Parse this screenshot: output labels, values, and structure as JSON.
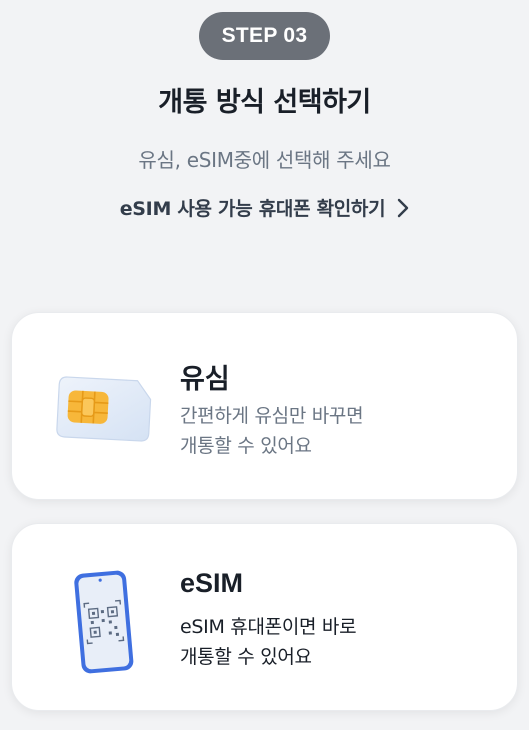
{
  "step_badge": "STEP 03",
  "title": "개통 방식 선택하기",
  "subtitle": "유심, eSIM중에 선택해 주세요",
  "check_link": "eSIM 사용 가능 휴대폰 확인하기",
  "options": [
    {
      "title": "유심",
      "desc_line1": "간편하게 유심만 바꾸면",
      "desc_line2": "개통할 수 있어요",
      "icon": "sim-card-icon"
    },
    {
      "title": "eSIM",
      "desc_line1": "eSIM 휴대폰이면 바로",
      "desc_line2": "개통할 수 있어요",
      "icon": "phone-qr-icon"
    }
  ],
  "colors": {
    "background": "#f2f3f5",
    "badge": "#6b7078",
    "text_primary": "#191f28",
    "text_secondary": "#6b7684",
    "chip_gold": "#f7b73a",
    "phone_blue": "#3f6fe0"
  }
}
